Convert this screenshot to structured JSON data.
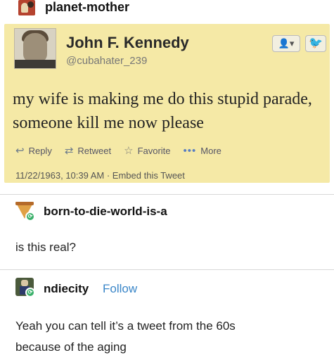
{
  "post": {
    "username": "planet-mother"
  },
  "tweet": {
    "name": "John F. Kennedy",
    "handle": "@cubahater_239",
    "follow_label": "▾",
    "text": "my wife is making me do this stupid parade, someone kill me now please",
    "actions": {
      "reply": "Reply",
      "retweet": "Retweet",
      "favorite": "Favorite",
      "more": "More"
    },
    "meta": "11/22/1963, 10:39 AM · Embed this Tweet"
  },
  "reblogs": [
    {
      "username": "born-to-die-world-is-a",
      "text": "is this real?"
    },
    {
      "username": "ndiecity",
      "follow": "Follow",
      "text_line1": "Yeah you can tell it’s a tweet from the 60s",
      "text_line2": "because of the aging"
    }
  ],
  "colors": {
    "tweet_bg": "#f5e9a6",
    "follow_link": "#3a86c8",
    "badge_green": "#3ab06a"
  },
  "icons": {
    "reply": "reply-arrow-icon",
    "retweet": "retweet-icon",
    "favorite": "star-icon",
    "more": "more-dots-icon",
    "twitter": "bird-icon",
    "follow": "person-add-icon"
  }
}
